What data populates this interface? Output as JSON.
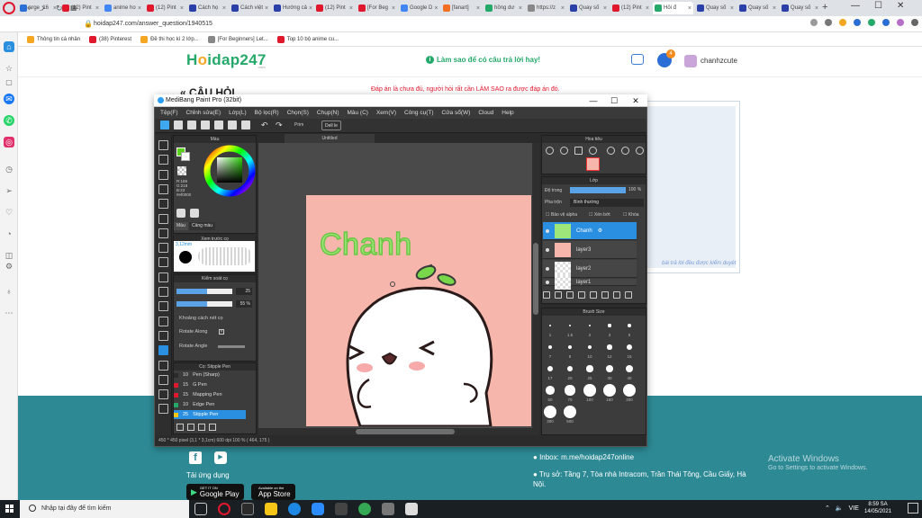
{
  "browser": {
    "tabs": [
      {
        "label": "arge_16",
        "color": "#2b6fd6"
      },
      {
        "label": "(12) Pint",
        "color": "#e0182d"
      },
      {
        "label": "anime ho",
        "color": "#4285f4"
      },
      {
        "label": "(12) Pint",
        "color": "#e0182d"
      },
      {
        "label": "Cách họ",
        "color": "#2b3fa8"
      },
      {
        "label": "Cách việt",
        "color": "#2b3fa8"
      },
      {
        "label": "Hướng cả",
        "color": "#2b3fa8"
      },
      {
        "label": "(12) Pint",
        "color": "#e0182d"
      },
      {
        "label": "[For Beg",
        "color": "#e0182d"
      },
      {
        "label": "Google D",
        "color": "#4285f4"
      },
      {
        "label": "[fanart]",
        "color": "#f36f21"
      },
      {
        "label": "hồng dư",
        "color": "#25a96a"
      },
      {
        "label": "https://z",
        "color": "#888888"
      },
      {
        "label": "Quay số",
        "color": "#2b3fa8"
      },
      {
        "label": "(12) Pint",
        "color": "#e0182d"
      },
      {
        "label": "Hỏi đ",
        "color": "#25a96a"
      },
      {
        "label": "Quay số",
        "color": "#2b3fa8"
      },
      {
        "label": "Quay số",
        "color": "#2b3fa8"
      },
      {
        "label": "Quay số",
        "color": "#2b3fa8"
      }
    ],
    "url": "hoidap247.com/answer_question/1940515",
    "bookmarks": [
      {
        "label": "Thông tin cá nhân",
        "color": "#f5a623"
      },
      {
        "label": "(38) Pinterest",
        "color": "#e0182d"
      },
      {
        "label": "Đề thi học kì 2 lớp...",
        "color": "#f5a623"
      },
      {
        "label": "[For Beginners] Let...",
        "color": "#888888"
      },
      {
        "label": "Top 10 bộ anime cu...",
        "color": "#e0182d"
      }
    ]
  },
  "site": {
    "logo_a": "H",
    "logo_b": "o",
    "logo_c": "idap247",
    "logo_sub": ".com",
    "hint": "Làm sao để có câu trả lời hay!",
    "notif_count": "4",
    "username": "chanhzcute",
    "section_title": "« CÂU HỎI",
    "warning": "Đáp án là chưa đủ, người hỏi rất cần LÀM SAO ra được đáp án đó.",
    "right_note": "bài trả lời đều được kiểm duyệt",
    "download_label": "Tải ứng dụng",
    "google_play_small": "GET IT ON",
    "google_play": "Google Play",
    "app_store_small": "Available on the",
    "app_store": "App Store",
    "inbox": "Inbox: m.me/hoidap247online",
    "address": "Trụ sở: Tầng 7, Tòa nhà Intracom, Trần Thái Tông, Cầu Giấy, Hà Nội.",
    "activate_title": "Activate Windows",
    "activate_sub": "Go to Settings to activate Windows."
  },
  "taskbar": {
    "search_placeholder": "Nhập tại đây để tìm kiếm",
    "lang": "VIE",
    "time": "8:59 SA",
    "date": "14/05/2021"
  },
  "medibang": {
    "title": "MediBang Paint Pro (32bit)",
    "menu": [
      "Tệp(F)",
      "Chỉnh sửa(E)",
      "Lớp(L)",
      "Bộ lọc(R)",
      "Chọn(S)",
      "Chụp(N)",
      "Màu (C)",
      "Xem(V)",
      "Công cụ(T)",
      "Cửa sổ(W)",
      "Cloud",
      "Help"
    ],
    "prim_label": "Prim",
    "dell_label": "Dell le",
    "canvas_tab": "Untitled",
    "canvas_text": "Chanh",
    "color_panel_title": "Màu",
    "color_values": [
      "R:169",
      "G:218",
      "B:23",
      "#ef0000"
    ],
    "color_tabs": [
      "Màu",
      "Cảng màu"
    ],
    "brush_preview_title": "Xem trước cọ",
    "brush_size_label": "3,12mm",
    "brush_ctrl_title": "Kiểm soát cọ",
    "brush_size_val": "25",
    "brush_opacity_val": "55 %",
    "opt_spacing": "Khoảng cách nét cọ",
    "opt_rotate_along": "Rotate Along",
    "opt_rotate_angle": "Rotate Angle",
    "brush_list_title": "Cọ: Stipple Pen",
    "brushes": [
      {
        "size": "10",
        "name": "Pen (Sharp)",
        "color": "#2a2a2a"
      },
      {
        "size": "15",
        "name": "G Pen",
        "color": "#e0182d"
      },
      {
        "size": "15",
        "name": "Mapping Pen",
        "color": "#e0182d"
      },
      {
        "size": "10",
        "name": "Edge Pen",
        "color": "#25a96a"
      },
      {
        "size": "25",
        "name": "Stipple Pen",
        "color": "#f5c518"
      }
    ],
    "nav_title": "Hoa tiêu",
    "layer_title": "Lớp",
    "opacity_label": "Độ trong",
    "opacity_val": "100 %",
    "blend_label": "Pha trộn",
    "blend_mode": "Bình thường",
    "chk_alpha": "Bảo vệ alpha",
    "chk_clip": "Xén bớt",
    "chk_draft": "Khóa",
    "layers": [
      {
        "name": "Chanh",
        "selected": true
      },
      {
        "name": "layer3",
        "selected": false
      },
      {
        "name": "layer2",
        "selected": false
      },
      {
        "name": "layer1",
        "selected": false
      }
    ],
    "brush_size_title": "Brush Size",
    "brush_sizes": [
      "1",
      "1.5",
      "2",
      "3",
      "5",
      "7",
      "8",
      "10",
      "12",
      "15",
      "17",
      "20",
      "25",
      "30",
      "40",
      "50",
      "70",
      "100",
      "150",
      "200",
      "300",
      "500"
    ],
    "status": "450 * 450 pixel  (3,1 * 3,1cm)  600 dpi  100 %  ( 464, 175 )"
  }
}
